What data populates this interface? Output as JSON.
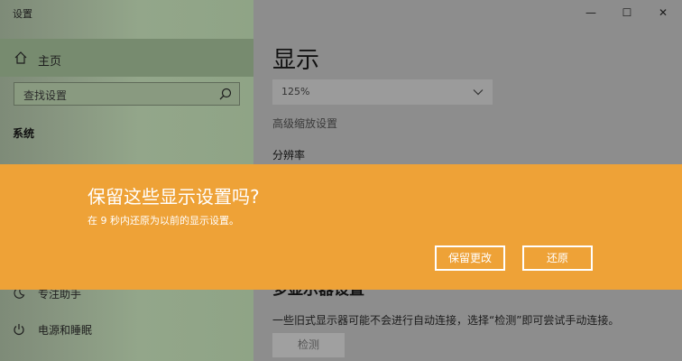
{
  "window": {
    "title": "设置",
    "minimize_glyph": "—",
    "maximize_glyph": "☐",
    "close_glyph": "✕"
  },
  "sidebar": {
    "home_label": "主页",
    "search_placeholder": "查找设置",
    "section_label": "系统",
    "items": [
      {
        "label": "专注助手",
        "icon": "moon-icon"
      },
      {
        "label": "电源和睡眠",
        "icon": "power-icon"
      }
    ]
  },
  "main": {
    "title": "显示",
    "scale_value": "125%",
    "advanced_scaling_link": "高级缩放设置",
    "resolution_label": "分辨率",
    "multi_display_heading": "多显示器设置",
    "detect_description": "一些旧式显示器可能不会进行自动连接，选择“检测”即可尝试手动连接。",
    "detect_button": "检测"
  },
  "dialog": {
    "title": "保留这些显示设置吗?",
    "message": "在 9 秒内还原为以前的显示设置。",
    "keep_button": "保留更改",
    "revert_button": "还原",
    "background_color": "#eea237"
  }
}
